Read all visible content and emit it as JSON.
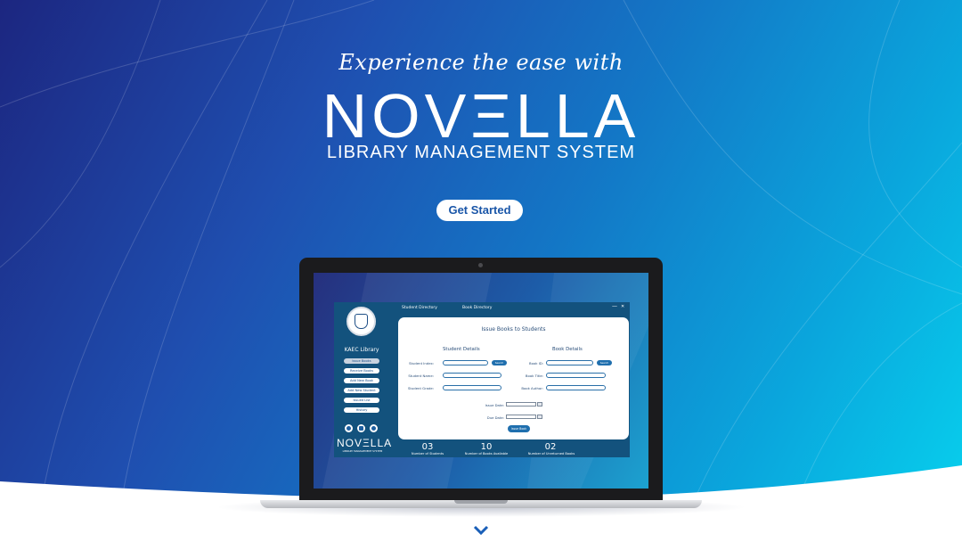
{
  "hero": {
    "tagline": "Experience the ease with",
    "brand": "NOVΞLLA",
    "subtitle": "LIBRARY MANAGEMENT SYSTEM",
    "cta_label": "Get Started"
  },
  "app": {
    "top_tabs": [
      "Student Directory",
      "Book Directory"
    ],
    "minimize": "—",
    "close": "✕",
    "library_name": "KAEC Library",
    "nav": [
      "Issue Books",
      "Receive Books",
      "Add New Book",
      "Add New Student",
      "Issued List",
      "History"
    ],
    "side_icons": [
      "droplet-icon",
      "document-icon",
      "user-icon"
    ],
    "side_brand": "NOVΞLLA",
    "side_brand_sub": "LIBRARY MANAGEMENT SYSTEM",
    "panel_title": "Issue Books to Students",
    "student_section": "Student Details",
    "book_section": "Book Details",
    "student_fields": [
      {
        "label": "Student Index:",
        "value": ""
      },
      {
        "label": "Student Name:",
        "value": ""
      },
      {
        "label": "Student Grade:",
        "value": ""
      }
    ],
    "book_fields": [
      {
        "label": "Book ID:",
        "value": ""
      },
      {
        "label": "Book Title:",
        "value": ""
      },
      {
        "label": "Book Author:",
        "value": ""
      }
    ],
    "search_label": "Search",
    "issue_date_label": "Issue Date:",
    "due_date_label": "Due Date:",
    "issue_button": "Issue Book",
    "stats": [
      {
        "value": "03",
        "label": "Number of Students"
      },
      {
        "value": "10",
        "label": "Number of Books Available"
      },
      {
        "value": "02",
        "label": "Number of Unreturned Books"
      }
    ]
  },
  "colors": {
    "accent": "#1f6fae",
    "app_bg": "#13527d",
    "cta_text": "#1a56a8"
  }
}
